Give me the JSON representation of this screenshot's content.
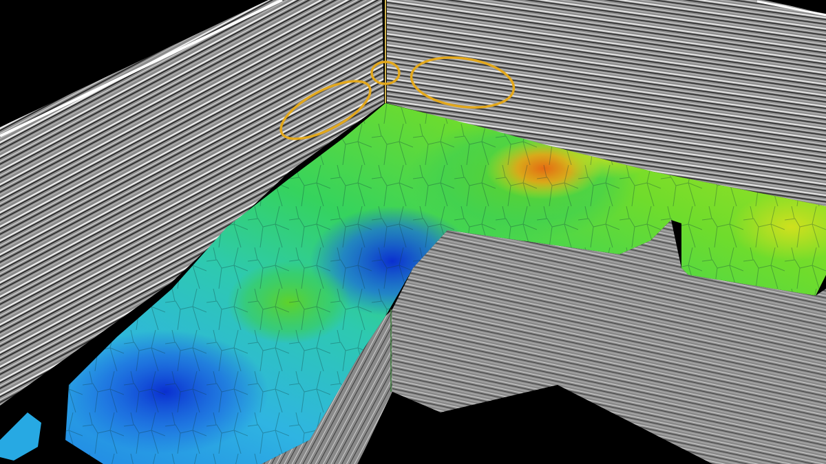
{
  "scene": {
    "description_visible_text": "",
    "background_color": "#000000",
    "seismic_gray": "#8a8a8a",
    "highlight_color": "#e3a81c",
    "horizon_palette": [
      "#0a3fd6",
      "#1f8fe6",
      "#2ec9d9",
      "#2fd36b",
      "#7fe02a",
      "#d9e01f",
      "#e87a12"
    ],
    "annotations": [
      {
        "name": "ellipse-left"
      },
      {
        "name": "ellipse-corner"
      },
      {
        "name": "ellipse-right"
      }
    ]
  }
}
